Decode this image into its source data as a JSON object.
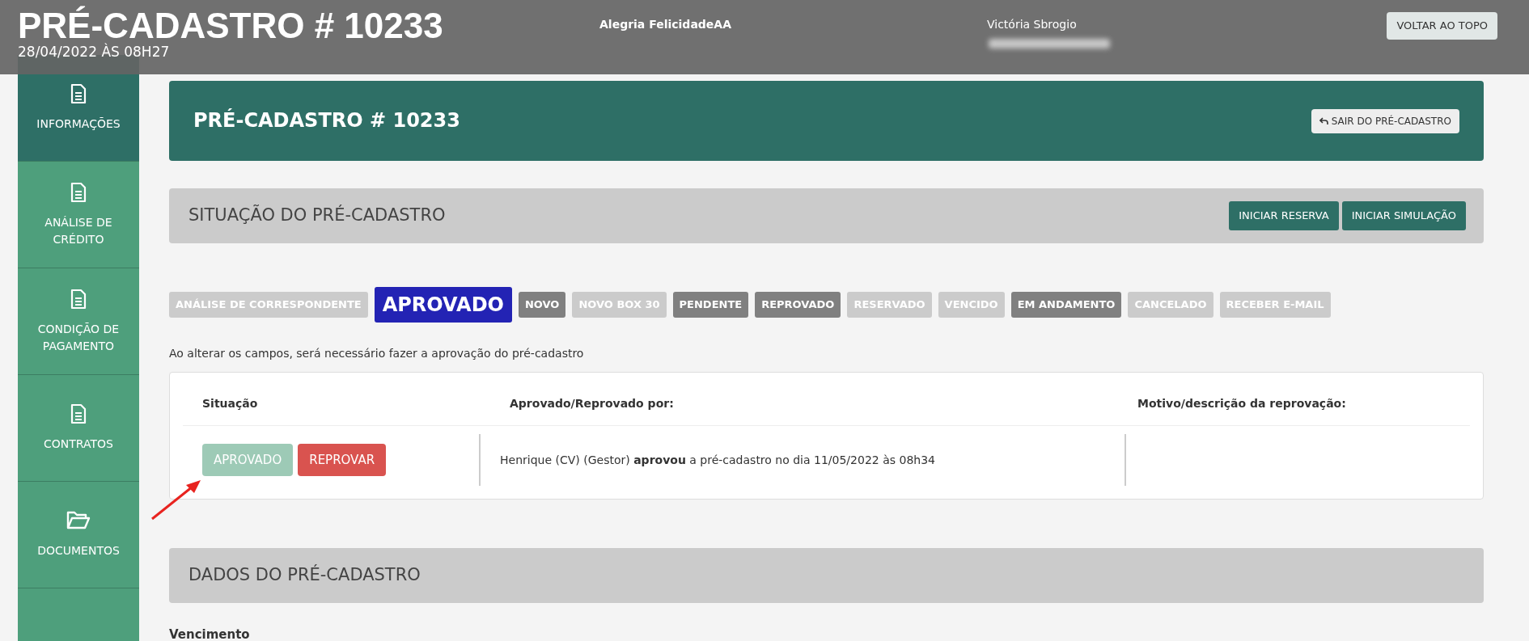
{
  "header": {
    "title": "PRÉ-CADASTRO # 10233",
    "date": "28/04/2022 ÀS 08H27",
    "user_1": "Alegria FelicidadeAA",
    "user_2": "Victória Sbrogio",
    "top_button": "VOLTAR AO TOPO"
  },
  "sidebar": {
    "items": [
      {
        "label": "INFORMAÇÕES",
        "selected": true
      },
      {
        "label": "ANÁLISE DE CRÉDITO",
        "selected": false
      },
      {
        "label": "CONDIÇÃO DE PAGAMENTO",
        "selected": false
      },
      {
        "label": "CONTRATOS",
        "selected": false
      },
      {
        "label": "DOCUMENTOS",
        "selected": false,
        "kind": "folder"
      }
    ]
  },
  "page_header": {
    "title": "PRÉ-CADASTRO # 10233",
    "exit_button": "SAIR DO PRÉ-CADASTRO"
  },
  "status_section": {
    "title": "SITUAÇÃO DO PRÉ-CADASTRO",
    "buttons": [
      "INICIAR RESERVA",
      "INICIAR SIMULAÇÃO"
    ]
  },
  "status_badges": [
    {
      "label": "ANÁLISE DE CORRESPONDENTE",
      "selected": false,
      "active": false
    },
    {
      "label": "APROVADO",
      "selected": true,
      "active": true
    },
    {
      "label": "NOVO",
      "selected": false,
      "active": true
    },
    {
      "label": "NOVO BOX 30",
      "selected": false,
      "active": false
    },
    {
      "label": "PENDENTE",
      "selected": false,
      "active": true
    },
    {
      "label": "REPROVADO",
      "selected": false,
      "active": true
    },
    {
      "label": "RESERVADO",
      "selected": false,
      "active": false
    },
    {
      "label": "VENCIDO",
      "selected": false,
      "active": false
    },
    {
      "label": "EM ANDAMENTO",
      "selected": false,
      "active": true
    },
    {
      "label": "CANCELADO",
      "selected": false,
      "active": false
    },
    {
      "label": "RECEBER E-MAIL",
      "selected": false,
      "active": false
    }
  ],
  "notice": "Ao alterar os campos, será necessário fazer a aprovação do pré-cadastro",
  "approval_table": {
    "columns": [
      "Situação",
      "Aprovado/Reprovado por:",
      "Motivo/descrição da reprovação:"
    ],
    "approve_button": {
      "label": "APROVADO",
      "disabled": true
    },
    "reject_button": "REPROVAR",
    "approved_by": "Henrique (CV) (Gestor) **aprovou** a pré-cadastro no dia 11/05/2022 às 08h34"
  },
  "data_section": {
    "title": "DADOS DO PRÉ-CADASTRO",
    "field_label": "Vencimento"
  }
}
